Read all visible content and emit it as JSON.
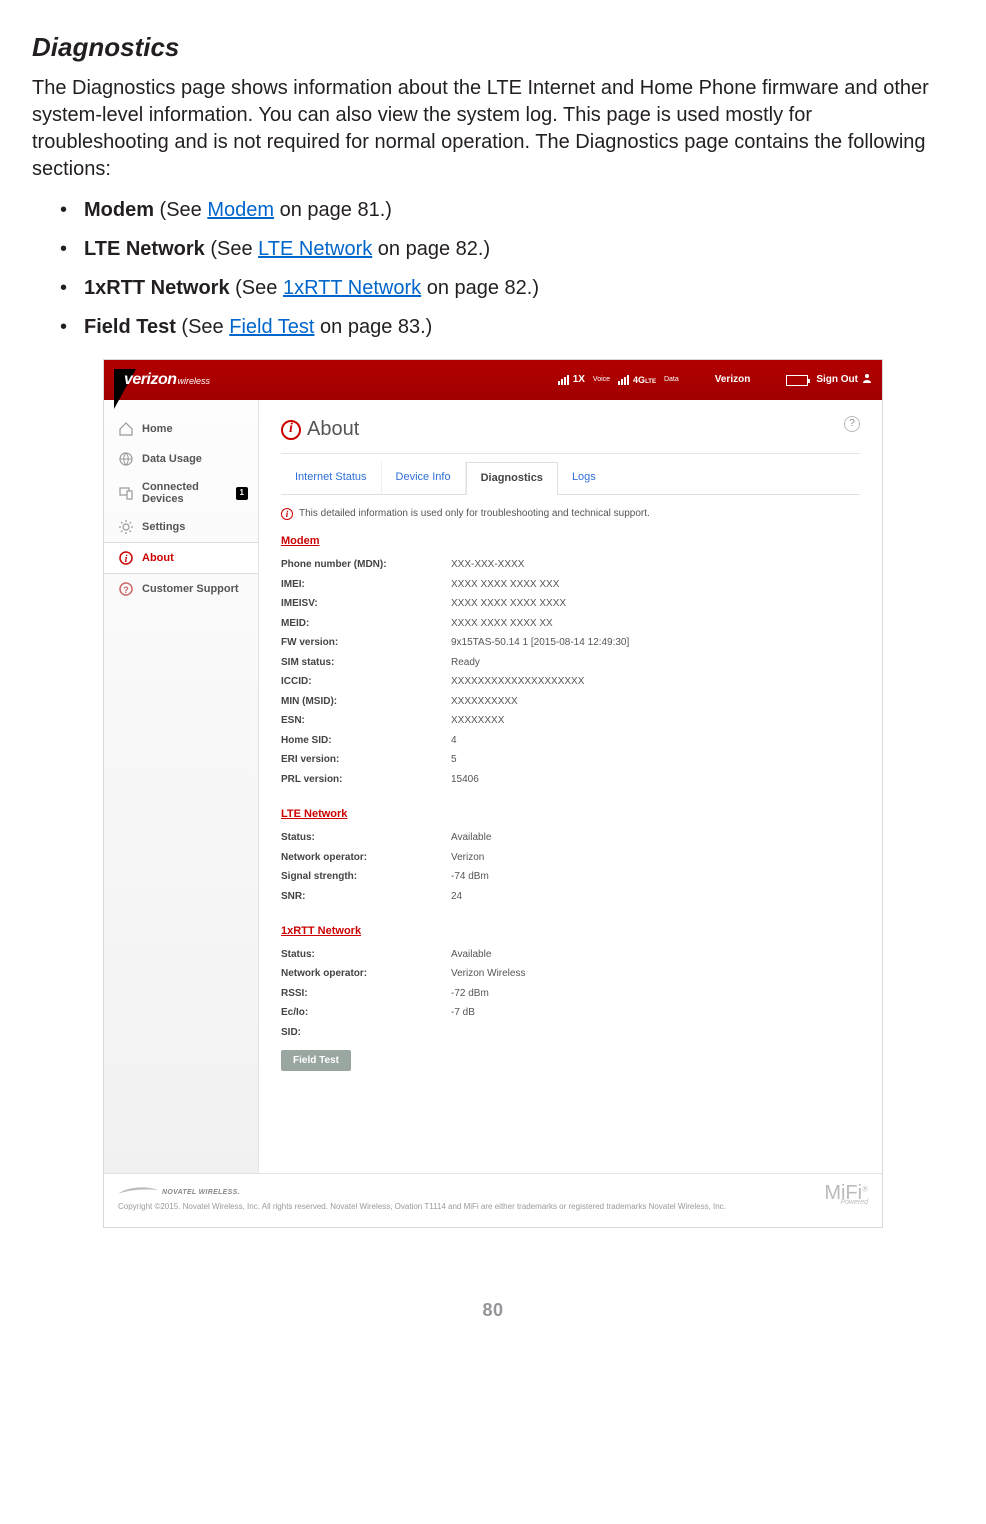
{
  "doc": {
    "heading": "Diagnostics",
    "intro": "The Diagnostics page shows information about the LTE Internet and Home Phone firmware and other system-level information. You can also view the system log. This page is used mostly for troubleshooting and is not required for normal operation. The Diagnostics page contains the following sections:",
    "items": [
      {
        "bold": "Modem",
        "mid": " (See ",
        "link": "Modem",
        "tail": " on page 81.)"
      },
      {
        "bold": "LTE Network",
        "mid": " (See ",
        "link": "LTE Network",
        "tail": " on page 82.)"
      },
      {
        "bold": "1xRTT Network",
        "mid": " (See ",
        "link": "1xRTT Network",
        "tail": " on page 82.)"
      },
      {
        "bold": "Field Test",
        "mid": " (See ",
        "link": "Field Test",
        "tail": " on page 83.)"
      }
    ],
    "page_number": "80"
  },
  "ui": {
    "brand": {
      "main": "verizon",
      "sub": "wireless"
    },
    "topbar": {
      "voice_tag": "1X",
      "voice_lbl": "Voice",
      "data_lbl": "Data",
      "net_tag": "4G LTE",
      "carrier": "Verizon",
      "signout": "Sign Out"
    },
    "sidebar": {
      "items": [
        {
          "label": "Home"
        },
        {
          "label": "Data Usage"
        },
        {
          "label": "Connected Devices",
          "badge": "1"
        },
        {
          "label": "Settings"
        },
        {
          "label": "About"
        },
        {
          "label": "Customer Support"
        }
      ]
    },
    "page": {
      "title": "About",
      "tabs": [
        "Internet Status",
        "Device Info",
        "Diagnostics",
        "Logs"
      ],
      "active_tab": 2,
      "note": "This detailed information is used only for troubleshooting and technical support.",
      "sections": {
        "modem": {
          "head": "Modem",
          "rows": [
            {
              "k": "Phone number (MDN):",
              "v": "XXX-XXX-XXXX"
            },
            {
              "k": "IMEI:",
              "v": "XXXX XXXX XXXX XXX"
            },
            {
              "k": "IMEISV:",
              "v": "XXXX XXXX XXXX XXXX"
            },
            {
              "k": "MEID:",
              "v": "XXXX XXXX XXXX XX"
            },
            {
              "k": "FW version:",
              "v": "9x15TAS-50.14 1 [2015-08-14 12:49:30]"
            },
            {
              "k": "SIM status:",
              "v": "Ready"
            },
            {
              "k": "ICCID:",
              "v": "XXXXXXXXXXXXXXXXXXXX"
            },
            {
              "k": "MIN (MSID):",
              "v": "XXXXXXXXXX"
            },
            {
              "k": "ESN:",
              "v": "XXXXXXXX"
            },
            {
              "k": "Home SID:",
              "v": "4"
            },
            {
              "k": "ERI version:",
              "v": "5"
            },
            {
              "k": "PRL version:",
              "v": "15406"
            }
          ]
        },
        "lte": {
          "head": "LTE Network",
          "rows": [
            {
              "k": "Status:",
              "v": "Available"
            },
            {
              "k": "Network operator:",
              "v": "Verizon"
            },
            {
              "k": "Signal strength:",
              "v": "-74 dBm"
            },
            {
              "k": "SNR:",
              "v": "24"
            }
          ]
        },
        "rtt": {
          "head": "1xRTT Network",
          "rows": [
            {
              "k": "Status:",
              "v": "Available"
            },
            {
              "k": "Network operator:",
              "v": "Verizon Wireless"
            },
            {
              "k": "RSSI:",
              "v": "-72 dBm"
            },
            {
              "k": "Ec/Io:",
              "v": "-7 dB"
            },
            {
              "k": "SID:",
              "v": ""
            }
          ]
        }
      },
      "fieldtest_btn": "Field Test"
    },
    "footer": {
      "brand": "NOVATEL WIRELESS.",
      "copy": "Copyright ©2015. Novatel Wireless, Inc. All rights reserved. Novatel Wireless, Ovation T1114 and MiFi are either trademarks or registered trademarks Novatel Wireless, Inc.",
      "mifi": "MiFi",
      "mifi_sub": "Powered"
    }
  }
}
